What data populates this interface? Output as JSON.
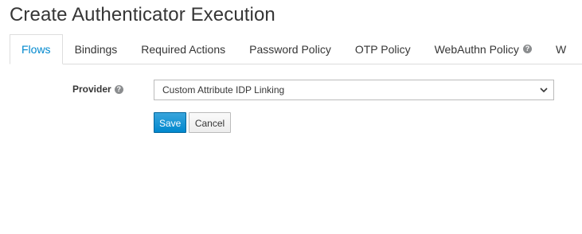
{
  "page": {
    "title": "Create Authenticator Execution"
  },
  "tabs": [
    {
      "label": "Flows",
      "active": true
    },
    {
      "label": "Bindings",
      "active": false
    },
    {
      "label": "Required Actions",
      "active": false
    },
    {
      "label": "Password Policy",
      "active": false
    },
    {
      "label": "OTP Policy",
      "active": false
    },
    {
      "label": "WebAuthn Policy",
      "active": false,
      "help_icon": true
    },
    {
      "label": "W",
      "active": false
    }
  ],
  "form": {
    "provider_label": "Provider",
    "provider_value": "Custom Attribute IDP Linking"
  },
  "buttons": {
    "save_label": "Save",
    "cancel_label": "Cancel"
  },
  "icons": {
    "help": "question-circle-icon",
    "dropdown": "chevron-down-icon"
  },
  "colors": {
    "accent": "#0088ce",
    "text": "#363636",
    "help_icon": "#8b8d8f"
  }
}
